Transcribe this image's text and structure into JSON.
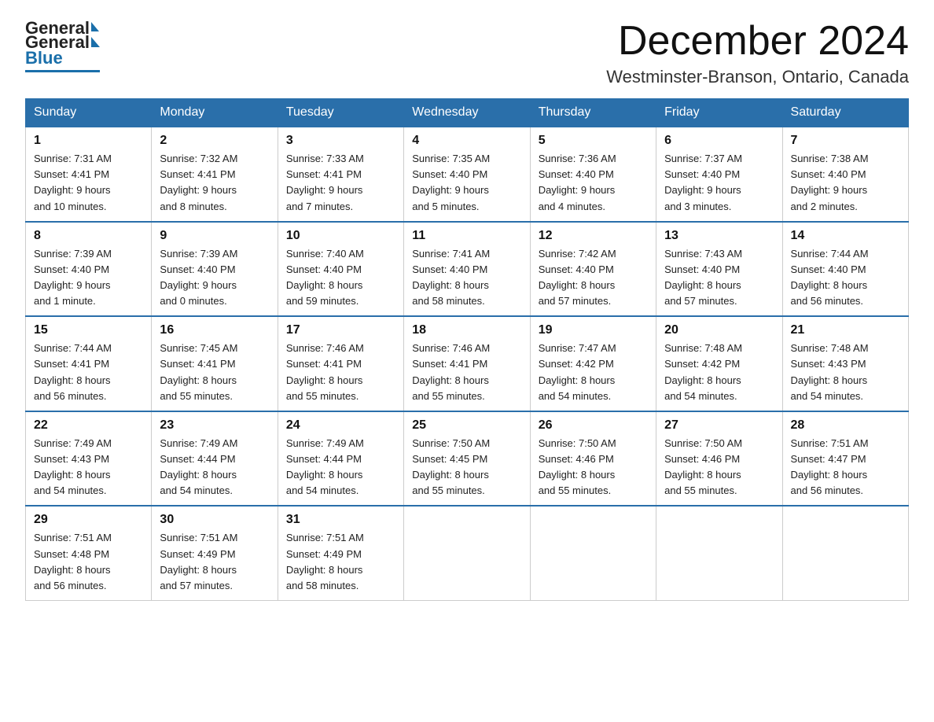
{
  "logo": {
    "general": "General",
    "blue": "Blue"
  },
  "title": "December 2024",
  "location": "Westminster-Branson, Ontario, Canada",
  "days_of_week": [
    "Sunday",
    "Monday",
    "Tuesday",
    "Wednesday",
    "Thursday",
    "Friday",
    "Saturday"
  ],
  "weeks": [
    [
      {
        "day": "1",
        "sunrise": "Sunrise: 7:31 AM",
        "sunset": "Sunset: 4:41 PM",
        "daylight": "Daylight: 9 hours",
        "daylight2": "and 10 minutes."
      },
      {
        "day": "2",
        "sunrise": "Sunrise: 7:32 AM",
        "sunset": "Sunset: 4:41 PM",
        "daylight": "Daylight: 9 hours",
        "daylight2": "and 8 minutes."
      },
      {
        "day": "3",
        "sunrise": "Sunrise: 7:33 AM",
        "sunset": "Sunset: 4:41 PM",
        "daylight": "Daylight: 9 hours",
        "daylight2": "and 7 minutes."
      },
      {
        "day": "4",
        "sunrise": "Sunrise: 7:35 AM",
        "sunset": "Sunset: 4:40 PM",
        "daylight": "Daylight: 9 hours",
        "daylight2": "and 5 minutes."
      },
      {
        "day": "5",
        "sunrise": "Sunrise: 7:36 AM",
        "sunset": "Sunset: 4:40 PM",
        "daylight": "Daylight: 9 hours",
        "daylight2": "and 4 minutes."
      },
      {
        "day": "6",
        "sunrise": "Sunrise: 7:37 AM",
        "sunset": "Sunset: 4:40 PM",
        "daylight": "Daylight: 9 hours",
        "daylight2": "and 3 minutes."
      },
      {
        "day": "7",
        "sunrise": "Sunrise: 7:38 AM",
        "sunset": "Sunset: 4:40 PM",
        "daylight": "Daylight: 9 hours",
        "daylight2": "and 2 minutes."
      }
    ],
    [
      {
        "day": "8",
        "sunrise": "Sunrise: 7:39 AM",
        "sunset": "Sunset: 4:40 PM",
        "daylight": "Daylight: 9 hours",
        "daylight2": "and 1 minute."
      },
      {
        "day": "9",
        "sunrise": "Sunrise: 7:39 AM",
        "sunset": "Sunset: 4:40 PM",
        "daylight": "Daylight: 9 hours",
        "daylight2": "and 0 minutes."
      },
      {
        "day": "10",
        "sunrise": "Sunrise: 7:40 AM",
        "sunset": "Sunset: 4:40 PM",
        "daylight": "Daylight: 8 hours",
        "daylight2": "and 59 minutes."
      },
      {
        "day": "11",
        "sunrise": "Sunrise: 7:41 AM",
        "sunset": "Sunset: 4:40 PM",
        "daylight": "Daylight: 8 hours",
        "daylight2": "and 58 minutes."
      },
      {
        "day": "12",
        "sunrise": "Sunrise: 7:42 AM",
        "sunset": "Sunset: 4:40 PM",
        "daylight": "Daylight: 8 hours",
        "daylight2": "and 57 minutes."
      },
      {
        "day": "13",
        "sunrise": "Sunrise: 7:43 AM",
        "sunset": "Sunset: 4:40 PM",
        "daylight": "Daylight: 8 hours",
        "daylight2": "and 57 minutes."
      },
      {
        "day": "14",
        "sunrise": "Sunrise: 7:44 AM",
        "sunset": "Sunset: 4:40 PM",
        "daylight": "Daylight: 8 hours",
        "daylight2": "and 56 minutes."
      }
    ],
    [
      {
        "day": "15",
        "sunrise": "Sunrise: 7:44 AM",
        "sunset": "Sunset: 4:41 PM",
        "daylight": "Daylight: 8 hours",
        "daylight2": "and 56 minutes."
      },
      {
        "day": "16",
        "sunrise": "Sunrise: 7:45 AM",
        "sunset": "Sunset: 4:41 PM",
        "daylight": "Daylight: 8 hours",
        "daylight2": "and 55 minutes."
      },
      {
        "day": "17",
        "sunrise": "Sunrise: 7:46 AM",
        "sunset": "Sunset: 4:41 PM",
        "daylight": "Daylight: 8 hours",
        "daylight2": "and 55 minutes."
      },
      {
        "day": "18",
        "sunrise": "Sunrise: 7:46 AM",
        "sunset": "Sunset: 4:41 PM",
        "daylight": "Daylight: 8 hours",
        "daylight2": "and 55 minutes."
      },
      {
        "day": "19",
        "sunrise": "Sunrise: 7:47 AM",
        "sunset": "Sunset: 4:42 PM",
        "daylight": "Daylight: 8 hours",
        "daylight2": "and 54 minutes."
      },
      {
        "day": "20",
        "sunrise": "Sunrise: 7:48 AM",
        "sunset": "Sunset: 4:42 PM",
        "daylight": "Daylight: 8 hours",
        "daylight2": "and 54 minutes."
      },
      {
        "day": "21",
        "sunrise": "Sunrise: 7:48 AM",
        "sunset": "Sunset: 4:43 PM",
        "daylight": "Daylight: 8 hours",
        "daylight2": "and 54 minutes."
      }
    ],
    [
      {
        "day": "22",
        "sunrise": "Sunrise: 7:49 AM",
        "sunset": "Sunset: 4:43 PM",
        "daylight": "Daylight: 8 hours",
        "daylight2": "and 54 minutes."
      },
      {
        "day": "23",
        "sunrise": "Sunrise: 7:49 AM",
        "sunset": "Sunset: 4:44 PM",
        "daylight": "Daylight: 8 hours",
        "daylight2": "and 54 minutes."
      },
      {
        "day": "24",
        "sunrise": "Sunrise: 7:49 AM",
        "sunset": "Sunset: 4:44 PM",
        "daylight": "Daylight: 8 hours",
        "daylight2": "and 54 minutes."
      },
      {
        "day": "25",
        "sunrise": "Sunrise: 7:50 AM",
        "sunset": "Sunset: 4:45 PM",
        "daylight": "Daylight: 8 hours",
        "daylight2": "and 55 minutes."
      },
      {
        "day": "26",
        "sunrise": "Sunrise: 7:50 AM",
        "sunset": "Sunset: 4:46 PM",
        "daylight": "Daylight: 8 hours",
        "daylight2": "and 55 minutes."
      },
      {
        "day": "27",
        "sunrise": "Sunrise: 7:50 AM",
        "sunset": "Sunset: 4:46 PM",
        "daylight": "Daylight: 8 hours",
        "daylight2": "and 55 minutes."
      },
      {
        "day": "28",
        "sunrise": "Sunrise: 7:51 AM",
        "sunset": "Sunset: 4:47 PM",
        "daylight": "Daylight: 8 hours",
        "daylight2": "and 56 minutes."
      }
    ],
    [
      {
        "day": "29",
        "sunrise": "Sunrise: 7:51 AM",
        "sunset": "Sunset: 4:48 PM",
        "daylight": "Daylight: 8 hours",
        "daylight2": "and 56 minutes."
      },
      {
        "day": "30",
        "sunrise": "Sunrise: 7:51 AM",
        "sunset": "Sunset: 4:49 PM",
        "daylight": "Daylight: 8 hours",
        "daylight2": "and 57 minutes."
      },
      {
        "day": "31",
        "sunrise": "Sunrise: 7:51 AM",
        "sunset": "Sunset: 4:49 PM",
        "daylight": "Daylight: 8 hours",
        "daylight2": "and 58 minutes."
      },
      null,
      null,
      null,
      null
    ]
  ]
}
